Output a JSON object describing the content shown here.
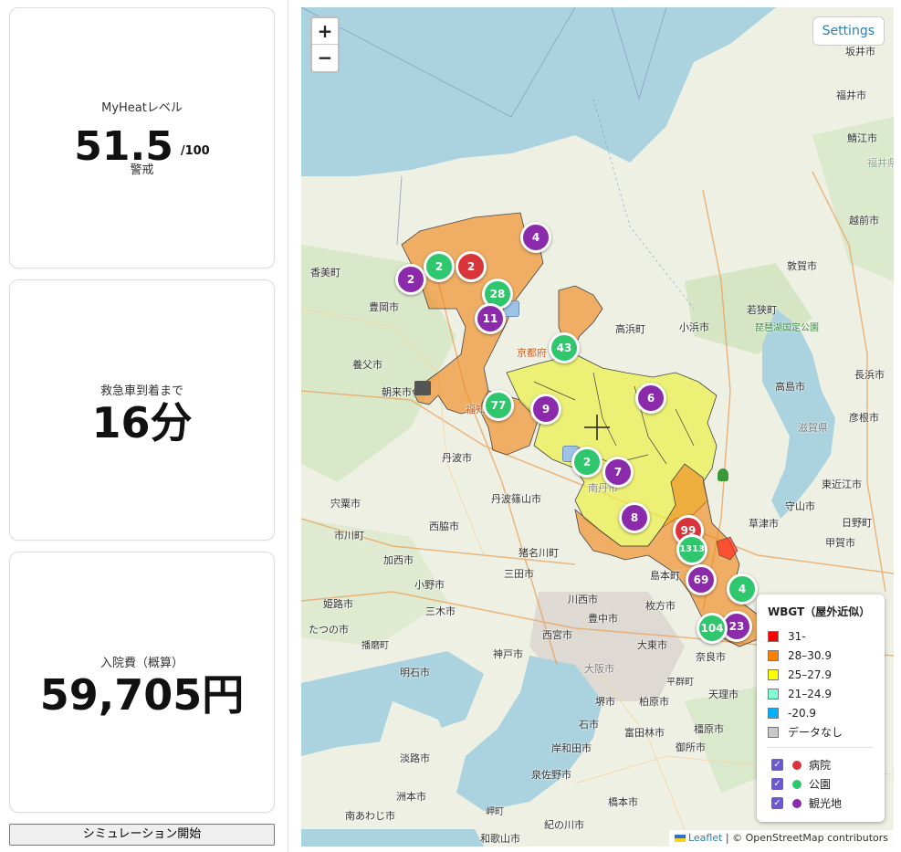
{
  "cards": {
    "heat": {
      "label": "MyHeatレベル",
      "value": "51.5",
      "unit": "/100",
      "status": "警戒"
    },
    "ambulance": {
      "label": "救急車到着まで",
      "value": "16分"
    },
    "cost": {
      "label": "入院費（概算）",
      "value": "59,705円"
    }
  },
  "simulation_button": "シミュレーション開始",
  "map": {
    "zoom_in": "+",
    "zoom_out": "−",
    "settings_label": "Settings",
    "attribution": {
      "leaflet": "Leaflet",
      "rest": "| © OpenStreetMap contributors"
    },
    "place_labels": [
      "坂井市",
      "福井市",
      "鯖江市",
      "福井県",
      "越前市",
      "敦賀市",
      "香美町",
      "豊岡市",
      "高浜町",
      "小浜市",
      "若狭町",
      "琵琶湖国定公園",
      "養父市",
      "長浜市",
      "朝来市",
      "高島市",
      "彦根市",
      "滋賀県",
      "丹波市",
      "東近江市",
      "宍粟市",
      "丹波篠山市",
      "守山市",
      "日野町",
      "市川町",
      "西脇市",
      "猪名川町",
      "草津市",
      "甲賀市",
      "加西市",
      "三田市",
      "島本町",
      "小野市",
      "姫路市",
      "三木市",
      "川西市",
      "枚方市",
      "たつの市",
      "豊中市",
      "播磨町",
      "西宮市",
      "大東市",
      "明石市",
      "神戸市",
      "奈良市",
      "大阪市",
      "平群町",
      "天理市",
      "堺市",
      "柏原市",
      "石市",
      "富田林市",
      "橿原市",
      "淡路市",
      "岸和田市",
      "御所市",
      "洲本市",
      "泉佐野市",
      "南あわじ市",
      "岬町",
      "橋本市",
      "和歌山市",
      "紀の川市",
      "京都府",
      "福知山市",
      "南丹市"
    ],
    "markers": [
      {
        "label": "4",
        "kind": "観光地"
      },
      {
        "label": "2",
        "kind": "観光地"
      },
      {
        "label": "2",
        "kind": "公園"
      },
      {
        "label": "2",
        "kind": "病院"
      },
      {
        "label": "28",
        "kind": "公園"
      },
      {
        "label": "11",
        "kind": "観光地"
      },
      {
        "label": "43",
        "kind": "公園"
      },
      {
        "label": "77",
        "kind": "公園"
      },
      {
        "label": "9",
        "kind": "観光地"
      },
      {
        "label": "6",
        "kind": "観光地"
      },
      {
        "label": "2",
        "kind": "公園"
      },
      {
        "label": "7",
        "kind": "観光地"
      },
      {
        "label": "8",
        "kind": "観光地"
      },
      {
        "label": "99",
        "kind": "病院"
      },
      {
        "label": "1313",
        "kind": "公園"
      },
      {
        "label": "69",
        "kind": "観光地"
      },
      {
        "label": "4",
        "kind": "公園"
      },
      {
        "label": "23",
        "kind": "観光地"
      },
      {
        "label": "104",
        "kind": "公園"
      }
    ]
  },
  "legend": {
    "title": "WBGT（屋外近似）",
    "ranges": [
      {
        "label": "31-",
        "color": "#ff0000"
      },
      {
        "label": "28–30.9",
        "color": "#ff8000"
      },
      {
        "label": "25–27.9",
        "color": "#ffff00"
      },
      {
        "label": "21–24.9",
        "color": "#80ffd0"
      },
      {
        "label": "-20.9",
        "color": "#00b0ff"
      },
      {
        "label": "データなし",
        "color": "#c8c8c8"
      }
    ],
    "layers": [
      {
        "label": "病院",
        "color": "#d9343a",
        "checked": true
      },
      {
        "label": "公園",
        "color": "#2fc66d",
        "checked": true
      },
      {
        "label": "観光地",
        "color": "#8b2aaa",
        "checked": true
      }
    ]
  }
}
